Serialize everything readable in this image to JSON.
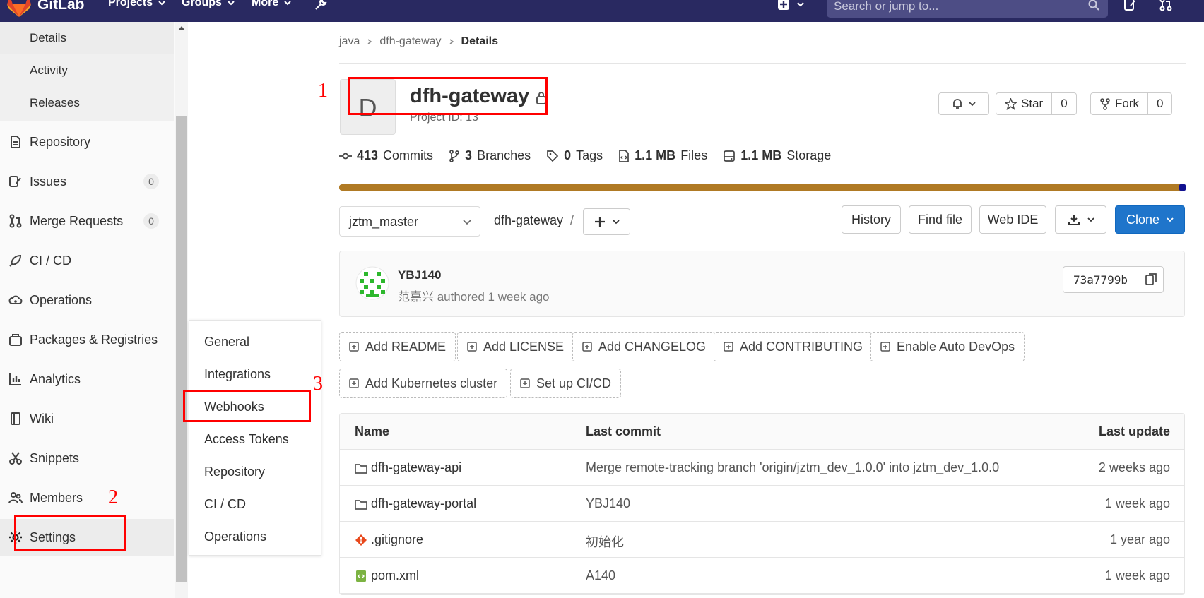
{
  "topnav": {
    "brand": "GitLab",
    "projects": "Projects",
    "groups": "Groups",
    "more": "More",
    "search_placeholder": "Search or jump to..."
  },
  "sidebar": {
    "sub_items": [
      {
        "label": "Details"
      },
      {
        "label": "Activity"
      },
      {
        "label": "Releases"
      }
    ],
    "items": [
      {
        "label": "Repository",
        "icon": "doc-icon"
      },
      {
        "label": "Issues",
        "icon": "issues-icon",
        "count": "0"
      },
      {
        "label": "Merge Requests",
        "icon": "merge-request-icon",
        "count": "0"
      },
      {
        "label": "CI / CD",
        "icon": "rocket-icon"
      },
      {
        "label": "Operations",
        "icon": "cloud-gear-icon"
      },
      {
        "label": "Packages & Registries",
        "icon": "package-icon"
      },
      {
        "label": "Analytics",
        "icon": "chart-icon"
      },
      {
        "label": "Wiki",
        "icon": "book-icon"
      },
      {
        "label": "Snippets",
        "icon": "scissors-icon"
      },
      {
        "label": "Members",
        "icon": "users-icon"
      },
      {
        "label": "Settings",
        "icon": "gear-icon"
      }
    ]
  },
  "settings_flyout": {
    "items": [
      "General",
      "Integrations",
      "Webhooks",
      "Access Tokens",
      "Repository",
      "CI / CD",
      "Operations"
    ]
  },
  "annotations": {
    "n1": "1",
    "n2": "2",
    "n3": "3",
    "color": "#ff0000"
  },
  "breadcrumb": {
    "group": "java",
    "project": "dfh-gateway",
    "current": "Details"
  },
  "project": {
    "avatar_letter": "D",
    "name": "dfh-gateway",
    "id_text": "Project ID: 13",
    "star_label": "Star",
    "star_count": "0",
    "fork_label": "Fork",
    "fork_count": "0"
  },
  "stats": {
    "commits_num": "413",
    "commits_label": "Commits",
    "branches_num": "3",
    "branches_label": "Branches",
    "tags_num": "0",
    "tags_label": "Tags",
    "files_num": "1.1 MB",
    "files_label": "Files",
    "storage_num": "1.1 MB",
    "storage_label": "Storage"
  },
  "languages": {
    "primary_color": "#b07a24",
    "secondary_color": "#101090"
  },
  "repo_nav": {
    "branch": "jztm_master",
    "path": "dfh-gateway",
    "path_sep": "/",
    "history": "History",
    "find_file": "Find file",
    "web_ide": "Web IDE",
    "clone": "Clone"
  },
  "last_commit": {
    "author": "YBJ140",
    "meta": "范嘉兴 authored 1 week ago",
    "sha": "73a7799b"
  },
  "quick_actions": [
    "Add README",
    "Add LICENSE",
    "Add CHANGELOG",
    "Add CONTRIBUTING",
    "Enable Auto DevOps",
    "Add Kubernetes cluster",
    "Set up CI/CD"
  ],
  "files_table": {
    "headers": {
      "name": "Name",
      "last_commit": "Last commit",
      "last_update": "Last update"
    },
    "rows": [
      {
        "name": "dfh-gateway-api",
        "type": "folder",
        "commit": "Merge remote-tracking branch 'origin/jztm_dev_1.0.0' into jztm_dev_1.0.0",
        "updated": "2 weeks ago"
      },
      {
        "name": "dfh-gateway-portal",
        "type": "folder",
        "commit": "YBJ140",
        "updated": "1 week ago"
      },
      {
        "name": ".gitignore",
        "type": "git",
        "commit": "初始化",
        "updated": "1 year ago"
      },
      {
        "name": "pom.xml",
        "type": "file",
        "commit": "A140",
        "updated": "1 week ago"
      }
    ]
  }
}
